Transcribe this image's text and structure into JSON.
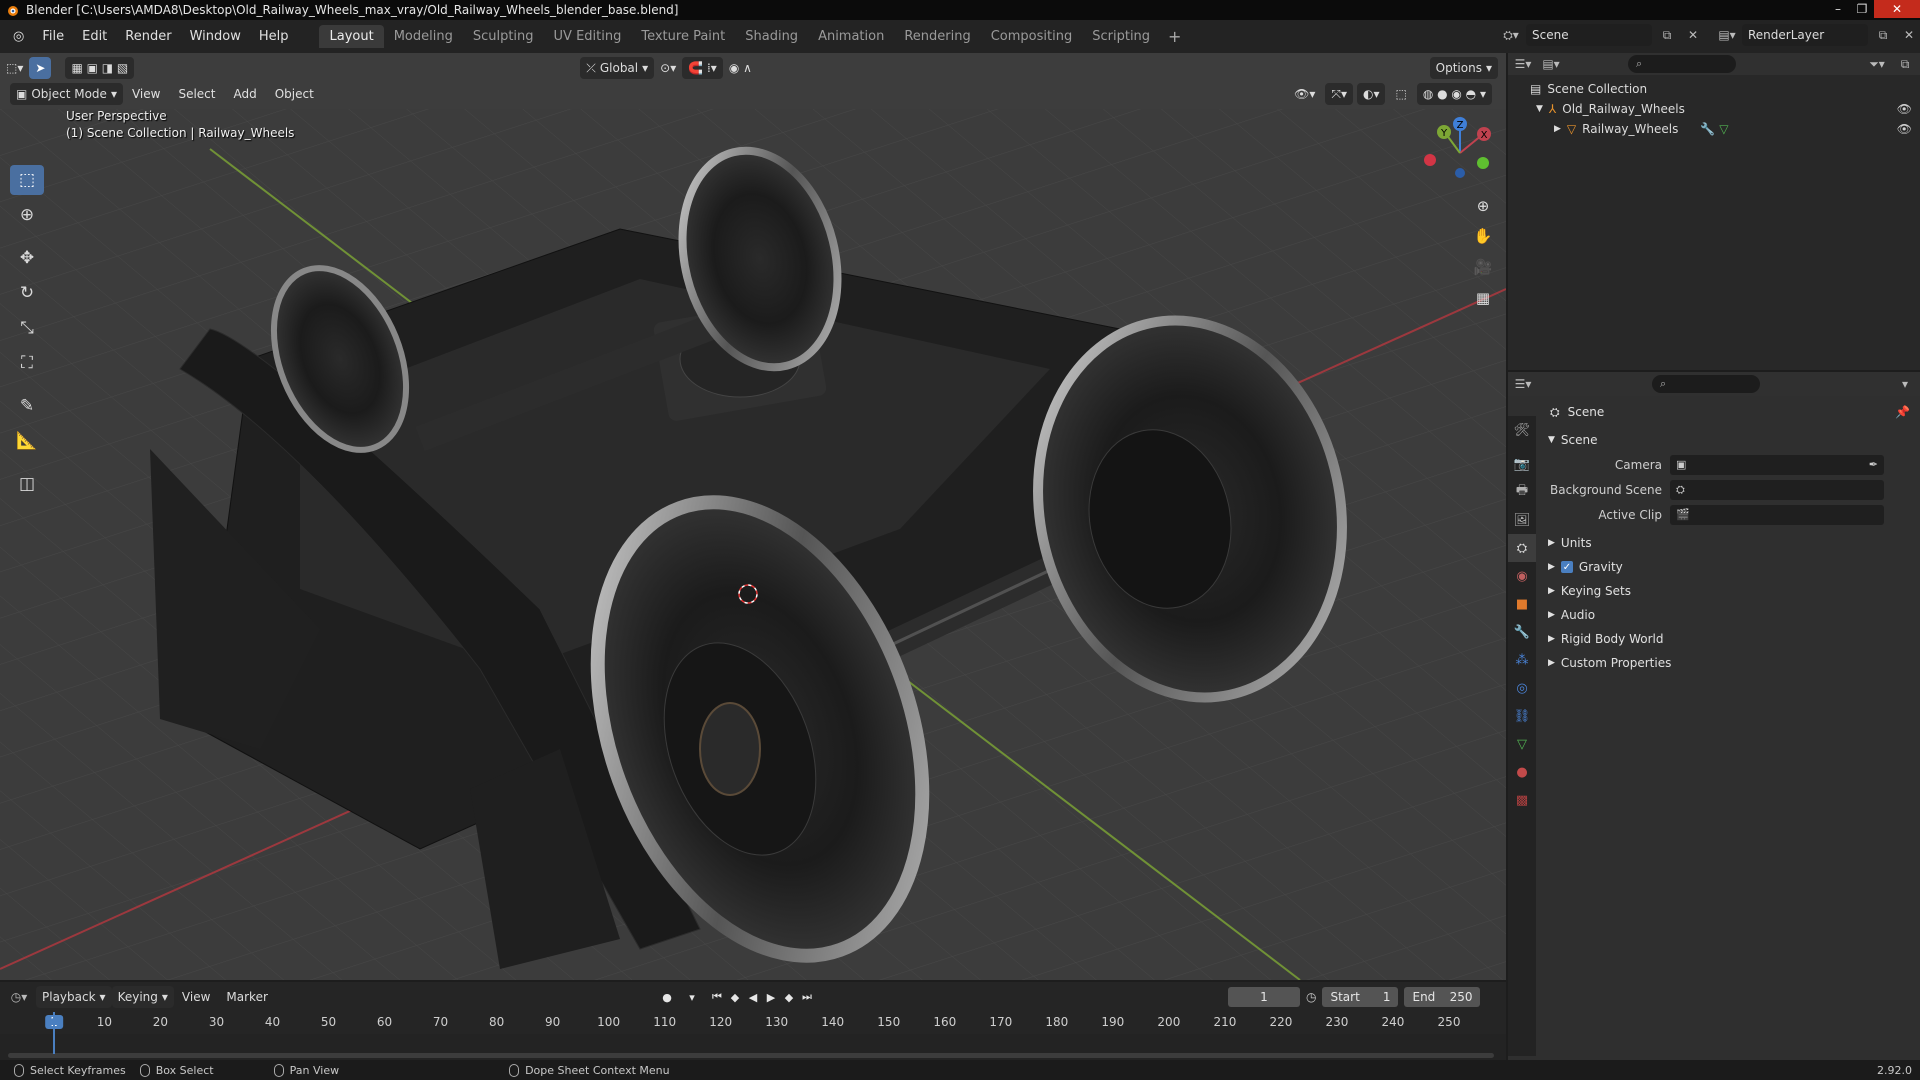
{
  "window": {
    "title": "Blender [C:\\Users\\AMDA8\\Desktop\\Old_Railway_Wheels_max_vray/Old_Railway_Wheels_blender_base.blend]",
    "controls": [
      "–",
      "❐",
      "✕"
    ]
  },
  "menu": [
    "File",
    "Edit",
    "Render",
    "Window",
    "Help"
  ],
  "workspaces": [
    "Layout",
    "Modeling",
    "Sculpting",
    "UV Editing",
    "Texture Paint",
    "Shading",
    "Animation",
    "Rendering",
    "Compositing",
    "Scripting"
  ],
  "active_workspace": "Layout",
  "scene_name": "Scene",
  "view_layer": "RenderLayer",
  "viewport": {
    "mode": "Object Mode",
    "menus": [
      "View",
      "Select",
      "Add",
      "Object"
    ],
    "orientation": "Global",
    "options_label": "Options",
    "perspective": "User Perspective",
    "collection_info": "(1) Scene Collection | Railway_Wheels",
    "axes": {
      "x": "X",
      "y": "Y",
      "z": "Z"
    }
  },
  "outliner": {
    "root": "Scene Collection",
    "items": [
      {
        "name": "Old_Railway_Wheels",
        "type": "collection"
      },
      {
        "name": "Railway_Wheels",
        "type": "mesh"
      }
    ]
  },
  "properties": {
    "title": "Scene",
    "panel": "Scene",
    "fields": [
      {
        "label": "Camera",
        "value": ""
      },
      {
        "label": "Background Scene",
        "value": ""
      },
      {
        "label": "Active Clip",
        "value": ""
      }
    ],
    "subpanels": [
      "Units",
      "Gravity",
      "Keying Sets",
      "Audio",
      "Rigid Body World",
      "Custom Properties"
    ],
    "gravity_enabled": true,
    "tab_colors": [
      "#9c9c9c",
      "#9c9c9c",
      "#9c9c9c",
      "#9c9c9c",
      "#b6b6b6",
      "#c05f5f",
      "#e07a2c",
      "#4a84d8",
      "#4a84d8",
      "#4a84d8",
      "#4a84d8",
      "#52b152",
      "#c24a4a",
      "#b04040"
    ]
  },
  "timeline": {
    "menus": [
      "Playback",
      "Keying",
      "View",
      "Marker"
    ],
    "current_frame": "1",
    "start_label": "Start",
    "start": "1",
    "end_label": "End",
    "end": "250",
    "ticks": [
      "1",
      "10",
      "20",
      "30",
      "40",
      "50",
      "60",
      "70",
      "80",
      "90",
      "100",
      "110",
      "120",
      "130",
      "140",
      "150",
      "160",
      "170",
      "180",
      "190",
      "200",
      "210",
      "220",
      "230",
      "240",
      "250"
    ]
  },
  "status": {
    "left": "Select Keyframes",
    "middle": "Box Select",
    "right": "Pan View",
    "context": "Dope Sheet Context Menu",
    "version": "2.92.0"
  },
  "colors": {
    "accent": "#4a6fa0",
    "x_axis": "#c0424f",
    "y_axis": "#7da735",
    "z_axis": "#3f7fd8"
  }
}
